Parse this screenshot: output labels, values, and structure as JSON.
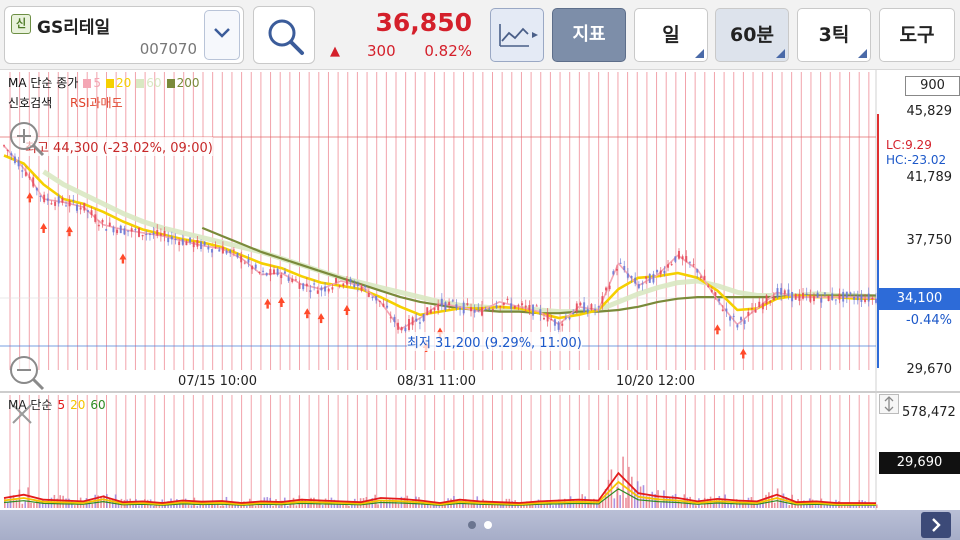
{
  "header": {
    "badge": "신",
    "stock_name": "GS리테일",
    "stock_code": "007070",
    "price": "36,850",
    "change_arrow": "▲",
    "change": "300",
    "change_pct": "0.82%",
    "indicator_label": "지표",
    "period_day": "일",
    "period_minutes": "60분",
    "tick": "3틱",
    "tools": "도구"
  },
  "price_panel": {
    "legend_title": "MA 단순 종가",
    "ma": [
      {
        "period": "5",
        "color": "#f4a6b4"
      },
      {
        "period": "20",
        "color": "#f5d000"
      },
      {
        "period": "60",
        "color": "#d9e8c2"
      },
      {
        "period": "200",
        "color": "#7a8a3a"
      }
    ],
    "signal_title": "신호검색",
    "signal_item": "RSI과매도",
    "max_label": "최고 44,300 (-23.02%, 09:00)",
    "min_label": "최저 31,200 (9.29%, 11:00)",
    "x_labels": [
      "07/15 10:00",
      "08/31 11:00",
      "10/20 12:00"
    ],
    "y_labels": [
      "45,829",
      "41,789",
      "37,750",
      "29,670"
    ],
    "y_box": "900",
    "lc": "LC:9.29",
    "hc": "HC:-23.02",
    "current_price": "34,100",
    "current_pct": "-0.44%"
  },
  "volume_panel": {
    "legend_title": "MA 단순",
    "ma": [
      {
        "period": "5",
        "color": "#e31b1b"
      },
      {
        "period": "20",
        "color": "#f5c400"
      },
      {
        "period": "60",
        "color": "#2e8b22"
      }
    ],
    "max_label": "578,472",
    "current_volume": "29,690"
  },
  "pager": {
    "pages": 2,
    "active": 1
  },
  "colors": {
    "up": "#d4202b",
    "down": "#1c58c9",
    "grid": "#f2a3ab",
    "candle_up": "#e64a5a",
    "candle_down": "#6b79d6"
  },
  "chart_data": {
    "type": "line",
    "title": "",
    "y_range": [
      29670,
      45829
    ],
    "x_ticks": [
      "07/15 10:00",
      "08/31 11:00",
      "10/20 12:00"
    ],
    "price_series": [
      {
        "name": "MA 5",
        "values": [
          43600,
          42200,
          40300,
          40100,
          39800,
          38700,
          38400,
          38200,
          38000,
          37700,
          37400,
          37200,
          36600,
          35600,
          35700,
          35000,
          34700,
          35200,
          34900,
          33900,
          32200,
          32900,
          33800,
          33600,
          33300,
          33900,
          33600,
          33300,
          32500,
          33600,
          33400,
          36300,
          34900,
          35600,
          36800,
          35900,
          34000,
          32500,
          33500,
          34500,
          34200,
          34200,
          34200,
          34200,
          34100
        ]
      },
      {
        "name": "MA 20",
        "values": [
          43000,
          42500,
          41200,
          40300,
          40000,
          39500,
          38900,
          38400,
          38100,
          37800,
          37600,
          37300,
          36800,
          36300,
          36000,
          35500,
          35100,
          34900,
          34700,
          34200,
          33600,
          33100,
          33300,
          33500,
          33500,
          33600,
          33500,
          33200,
          32900,
          33100,
          33400,
          34700,
          35400,
          35500,
          35700,
          35400,
          34600,
          33400,
          33500,
          34100,
          34300,
          34200,
          34200,
          34100,
          34100
        ]
      },
      {
        "name": "MA 60",
        "values": [
          null,
          null,
          42000,
          41200,
          40600,
          40000,
          39400,
          38900,
          38500,
          38200,
          37900,
          37600,
          37300,
          37000,
          36600,
          36200,
          35800,
          35400,
          35100,
          34800,
          34500,
          34200,
          33900,
          33700,
          33600,
          33500,
          33500,
          33400,
          33300,
          33300,
          33400,
          33900,
          34400,
          34800,
          35100,
          35200,
          34900,
          34500,
          34300,
          34300,
          34300,
          34400,
          34300,
          34300,
          34200
        ]
      },
      {
        "name": "MA 200",
        "values": [
          null,
          null,
          null,
          null,
          null,
          null,
          null,
          null,
          null,
          null,
          38500,
          38000,
          37500,
          37000,
          36600,
          36200,
          35800,
          35400,
          35000,
          34600,
          34200,
          33900,
          33700,
          33500,
          33400,
          33300,
          33300,
          33200,
          33200,
          33300,
          33300,
          33400,
          33600,
          33900,
          34100,
          34200,
          34200,
          34200,
          34200,
          34200,
          34300,
          34300,
          34300,
          34300,
          34300
        ]
      }
    ],
    "volume_ma5": [
      60000,
      80000,
      50000,
      45000,
      40000,
      70000,
      35000,
      40000,
      30000,
      45000,
      38000,
      42000,
      30000,
      40000,
      36000,
      50000,
      45000,
      40000,
      35000,
      60000,
      55000,
      45000,
      30000,
      50000,
      40000,
      35000,
      30000,
      40000,
      45000,
      50000,
      45000,
      210000,
      90000,
      70000,
      60000,
      40000,
      55000,
      45000,
      40000,
      80000,
      35000,
      40000,
      30000,
      30000,
      29690
    ],
    "volume_max": 578472
  }
}
